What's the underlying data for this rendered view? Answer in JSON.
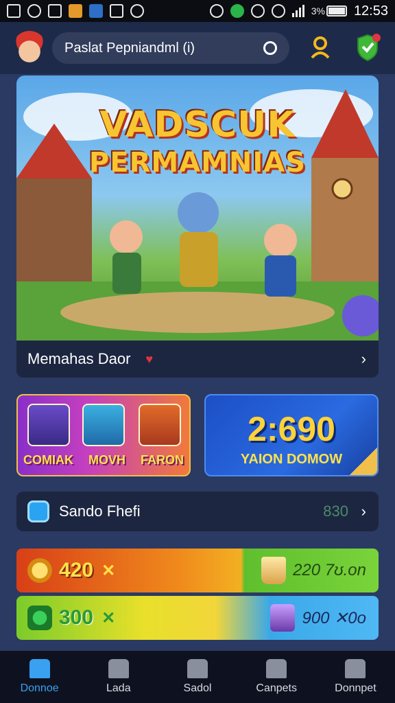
{
  "status_bar": {
    "battery": "3%",
    "time": "12:53",
    "icons": [
      "gallery-icon",
      "chrome-icon",
      "app-icon",
      "chart-icon",
      "image-icon",
      "mail-icon",
      "pin-icon",
      "bluetooth-icon",
      "phone-icon",
      "alarm-icon",
      "wifi-icon",
      "signal-icon"
    ]
  },
  "header": {
    "search_text": "Paslat Pepniandml (i)",
    "icons": [
      "avatar",
      "search-icon",
      "key-icon",
      "shield-icon"
    ]
  },
  "banner": {
    "title_line1": "VADSCUK",
    "title_line2": "PERMAMNIAS"
  },
  "info_row": {
    "label": "Memahas Daor"
  },
  "promo_left": {
    "labels": [
      "COMIAK",
      "MOVH",
      "FARON"
    ]
  },
  "promo_right": {
    "big": "2:690",
    "sub": "YAION DOMOW"
  },
  "list_row": {
    "label": "Sando Fhefi",
    "value": "830"
  },
  "rewards": [
    {
      "value": "420",
      "mult": "✕",
      "right": "220 7ʊ.on"
    },
    {
      "value": "300",
      "mult": "✕",
      "right": "900 ✕0o"
    }
  ],
  "nav": [
    {
      "label": "Donnoe",
      "icon": "home-icon",
      "active": true
    },
    {
      "label": "Lada",
      "icon": "hat-icon",
      "active": false
    },
    {
      "label": "Sadol",
      "icon": "cart-icon",
      "active": false
    },
    {
      "label": "Canpets",
      "icon": "person-icon",
      "active": false
    },
    {
      "label": "Donnpet",
      "icon": "profile-icon",
      "active": false
    }
  ],
  "colors": {
    "background": "#2b3a63",
    "header": "#1e2a4a",
    "accent": "#3aa0f0",
    "gold": "#ffd23a"
  }
}
